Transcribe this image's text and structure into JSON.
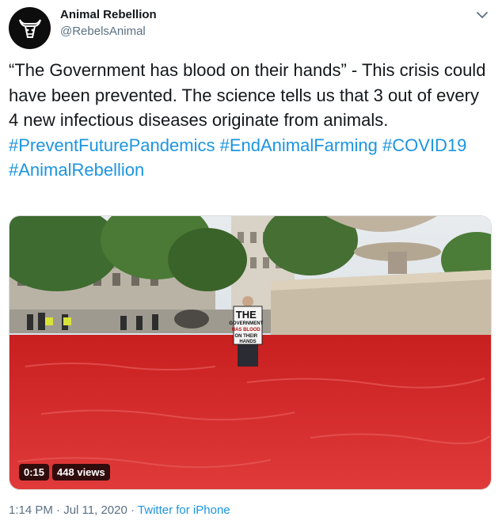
{
  "author": {
    "name": "Animal Rebellion",
    "handle": "@RebelsAnimal",
    "avatar_icon": "bull-head-icon"
  },
  "menu_icon": "chevron-down-icon",
  "tweet": {
    "text": "“The Government has blood on their hands” - This crisis could have been prevented. The science tells us that 3 out of every 4 new infectious diseases originate from animals.",
    "hashtags": [
      "#PreventFuturePandemics",
      "#EndAnimalFarming",
      "#COVID19",
      "#AnimalRebellion"
    ]
  },
  "media": {
    "duration": "0:15",
    "views": "448 views",
    "sign_lines": [
      "THE",
      "GOVERNMENT",
      "HAS BLOOD",
      "ON THEIR",
      "HANDS"
    ]
  },
  "meta": {
    "time": "1:14 PM",
    "date": "Jul 11, 2020",
    "separator": "·",
    "source": "Twitter for iPhone"
  },
  "colors": {
    "hashtag": "#1b95e0",
    "water": "#d42a2a",
    "muted": "#5b7083"
  }
}
